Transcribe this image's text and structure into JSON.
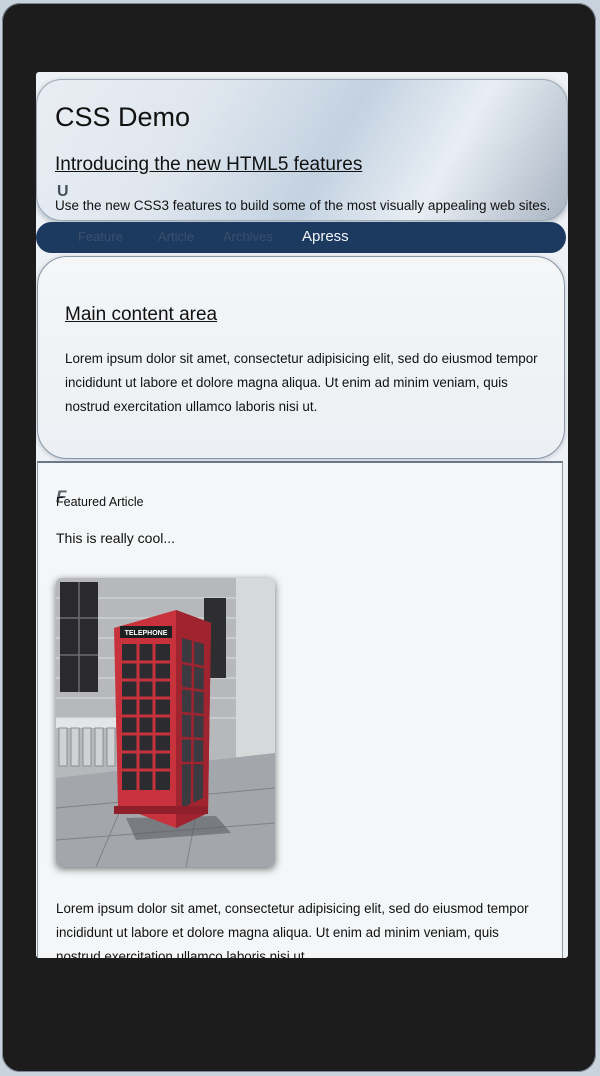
{
  "header": {
    "title": "CSS Demo",
    "subtitle": "Introducing the new HTML5 features",
    "tagline": "Use the new CSS3 features to build some of the most visually appealing web sites."
  },
  "nav": {
    "links": [
      {
        "label": "Feature",
        "active": false
      },
      {
        "label": "Article",
        "active": false
      },
      {
        "label": "Archives",
        "active": false
      },
      {
        "label": "Apress",
        "active": true
      }
    ]
  },
  "main": {
    "heading": "Main content area",
    "paragraph": "Lorem ipsum dolor sit amet, consectetur adipisicing elit, sed do eiusmod tempor incididunt ut labore et dolore magna aliqua. Ut enim ad minim veniam, quis nostrud exercitation ullamco laboris nisi ut."
  },
  "aside": {
    "heading": "Featured Article",
    "intro": "This is really cool...",
    "image_subject": "red telephone box",
    "image_sign": "TELEPHONE",
    "paragraph": "Lorem ipsum dolor sit amet, consectetur adipisicing elit, sed do eiusmod tempor incididunt ut labore et dolore magna aliqua. Ut enim ad minim veniam, quis nostrud exercitation ullamco laboris nisi ut."
  },
  "colors": {
    "nav_bar": "#1c3a60",
    "phone_box": "#c8323c",
    "device_frame": "#1c1c1c"
  }
}
